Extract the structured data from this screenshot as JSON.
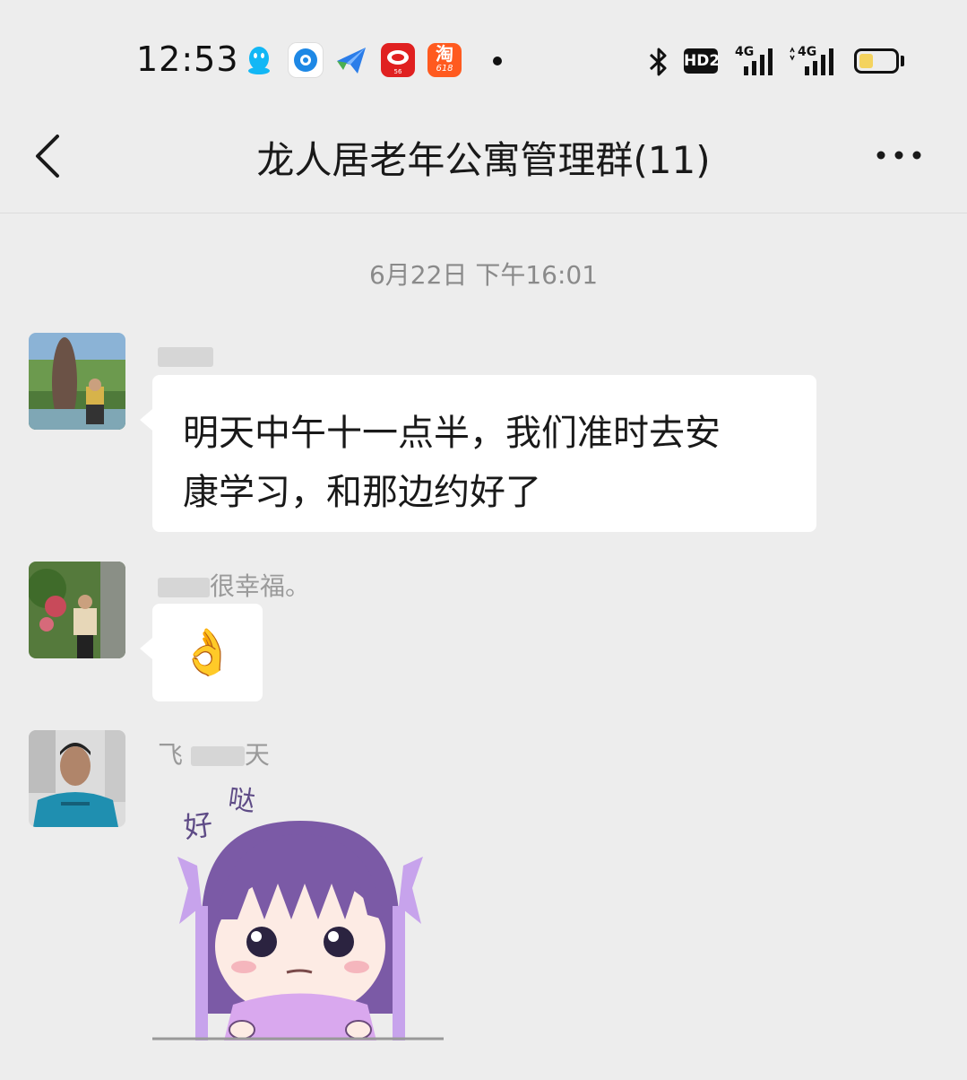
{
  "status_bar": {
    "time": "12:53",
    "hd_label": "HD2",
    "network_1": "4G",
    "network_2": "4G",
    "battery_level": 0.4,
    "app_icons": [
      "qq-icon",
      "browser-icon",
      "send-icon",
      "weibo-icon",
      "taobao-icon"
    ],
    "taobao_badge": "淘",
    "taobao_sub": "618",
    "weibo_sub": "56"
  },
  "header": {
    "title": "龙人居老年公寓管理群(11)"
  },
  "chat": {
    "timestamp": "6月22日 下午16:01",
    "messages": [
      {
        "sender_visible": "",
        "text_line1": "明天中午十一点半，我们准时去安",
        "text_line2": "康学习，和那边约好了"
      },
      {
        "sender_visible": "很幸福。",
        "emoji": "👌"
      },
      {
        "sender_visible_start": "飞",
        "sender_visible_end": "天",
        "sticker_text_1": "好",
        "sticker_text_2": "哒"
      }
    ]
  },
  "colors": {
    "background": "#ededed",
    "bubble": "#ffffff",
    "sticker_purple": "#7b5aa6"
  }
}
